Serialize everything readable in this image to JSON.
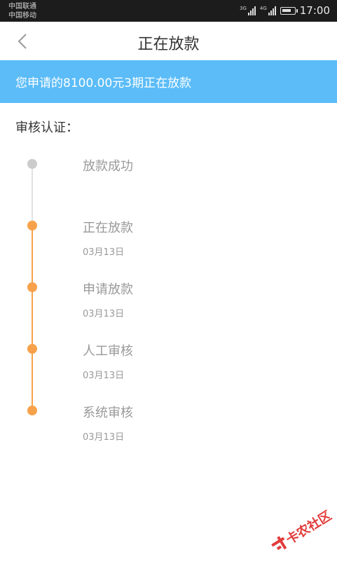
{
  "status_bar": {
    "carrier_1": "中国联通",
    "carrier_2": "中国移动",
    "network_1": "3G",
    "network_2": "4G",
    "time": "17:00"
  },
  "nav": {
    "title": "正在放款",
    "back_icon": "chevron-left-icon"
  },
  "banner": {
    "text": "您申请的8100.00元3期正在放款",
    "color": "#5bbcf8"
  },
  "section_title": "审核认证：",
  "timeline": {
    "active_color": "#f7a24a",
    "inactive_color": "#cccccc",
    "steps": [
      {
        "label": "放款成功",
        "date": "",
        "status": "pending"
      },
      {
        "label": "正在放款",
        "date": "03月13日",
        "status": "done"
      },
      {
        "label": "申请放款",
        "date": "03月13日",
        "status": "done"
      },
      {
        "label": "人工审核",
        "date": "03月13日",
        "status": "done"
      },
      {
        "label": "系统审核",
        "date": "03月13日",
        "status": "done"
      }
    ]
  },
  "watermark": {
    "text": "卡农社区"
  }
}
